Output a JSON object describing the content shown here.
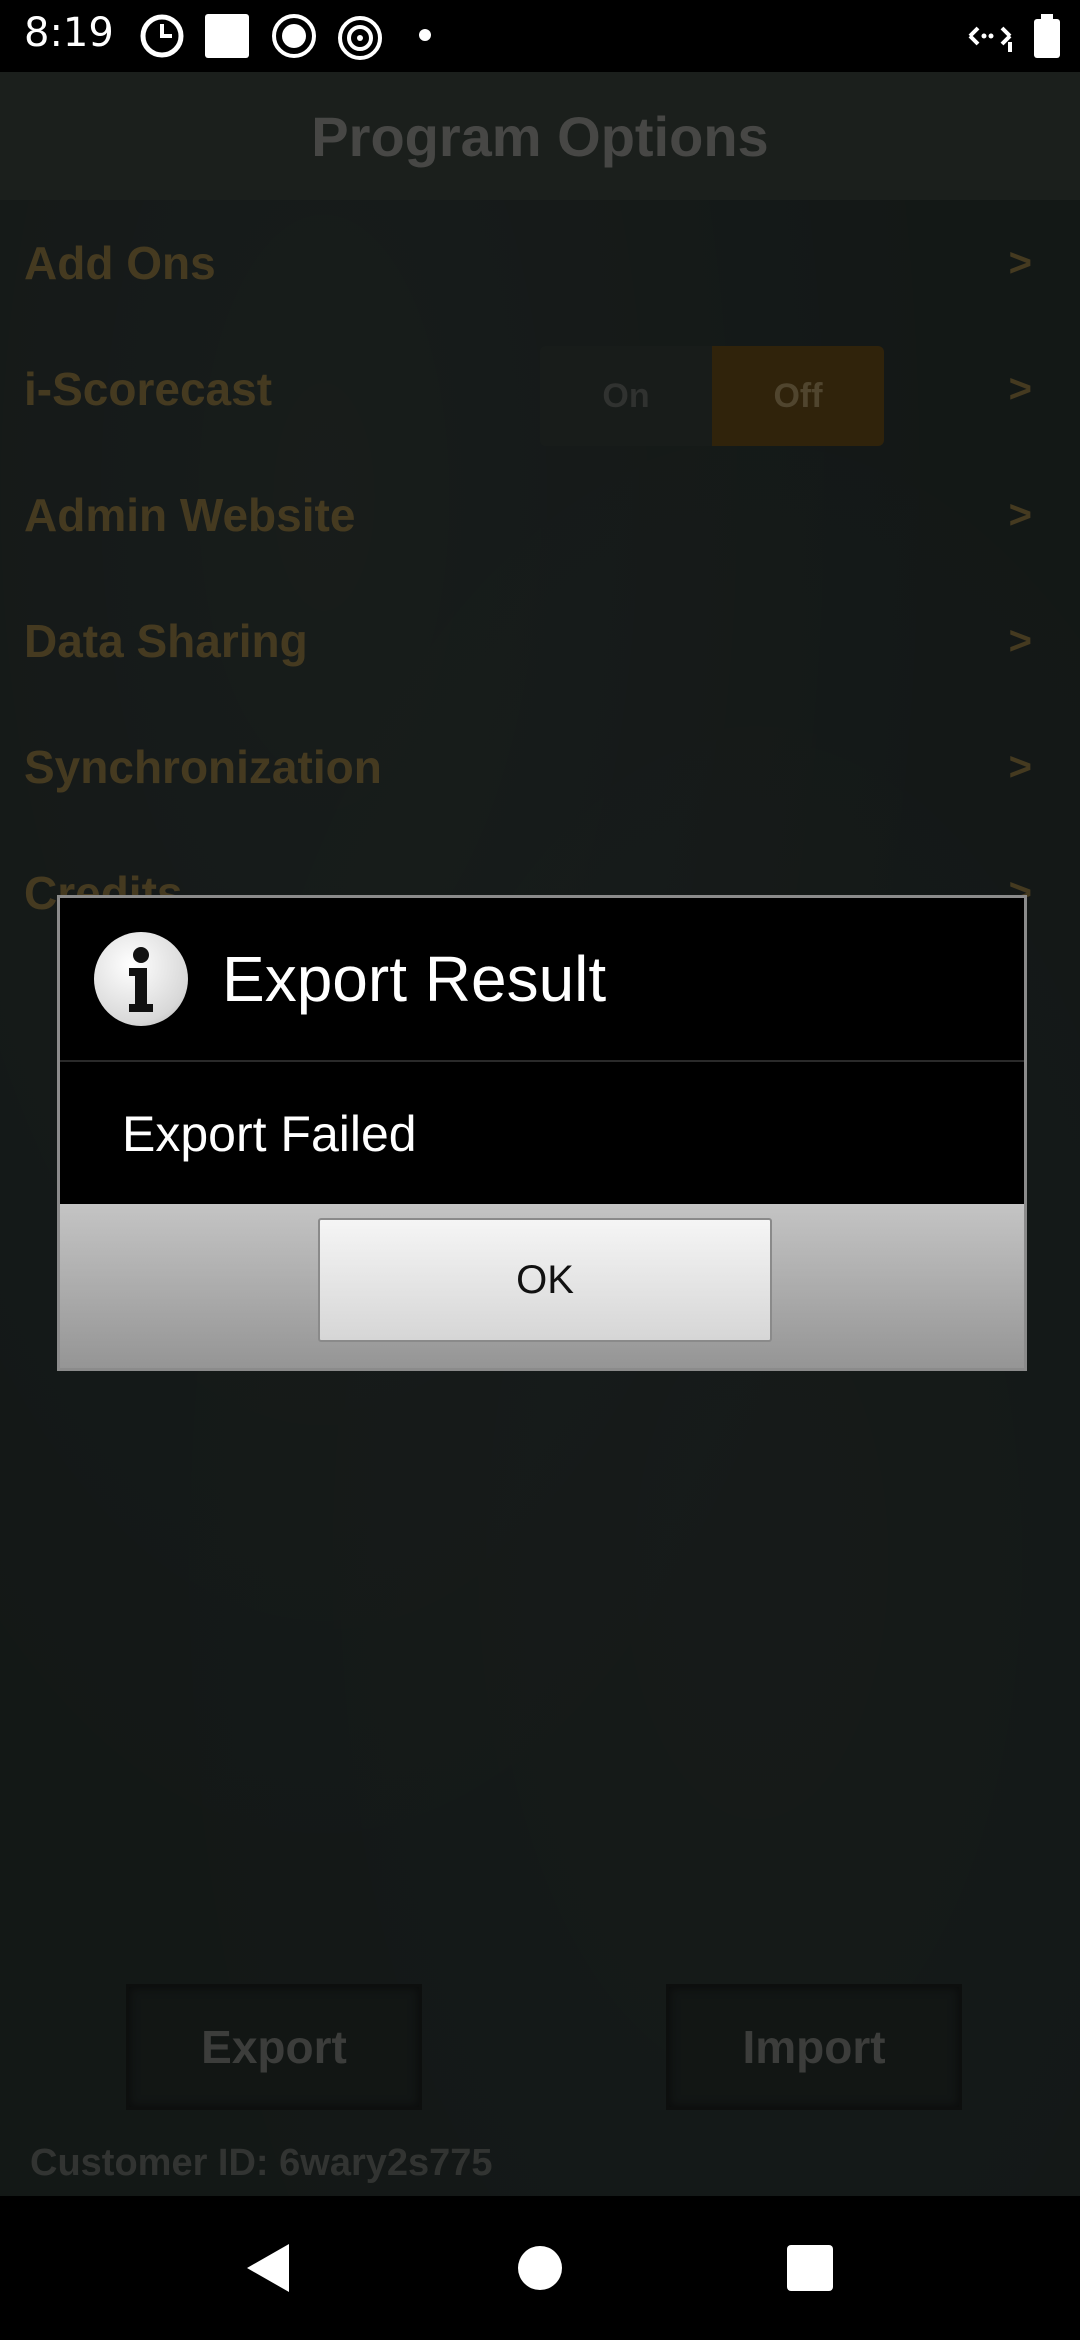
{
  "status_bar": {
    "time": "8:19",
    "left_icons": [
      "clock-icon",
      "square-icon",
      "record-icon",
      "target-icon",
      "dot-icon"
    ],
    "right_icons": [
      "signal-icon",
      "battery-icon"
    ]
  },
  "header": {
    "title": "Program Options"
  },
  "menu": {
    "items": [
      {
        "label": "Add Ons",
        "chevron": ">"
      },
      {
        "label": "i-Scorecast",
        "chevron": ">",
        "toggle": {
          "on_label": "On",
          "off_label": "Off",
          "selected": "Off"
        }
      },
      {
        "label": "Admin Website",
        "chevron": ">"
      },
      {
        "label": "Data Sharing",
        "chevron": ">"
      },
      {
        "label": "Synchronization",
        "chevron": ">"
      },
      {
        "label": "Credits",
        "chevron": ">"
      }
    ]
  },
  "actions": {
    "export_label": "Export",
    "import_label": "Import"
  },
  "customer": {
    "text": "Customer ID: 6wary2s775"
  },
  "dialog": {
    "title": "Export Result",
    "icon": "info-icon",
    "message": "Export Failed",
    "ok_label": "OK"
  },
  "nav": {
    "buttons": [
      "back-icon",
      "home-icon",
      "recents-icon"
    ]
  },
  "colors": {
    "accent_gold": "#6b5a32",
    "toggle_selected": "#4a3612"
  }
}
